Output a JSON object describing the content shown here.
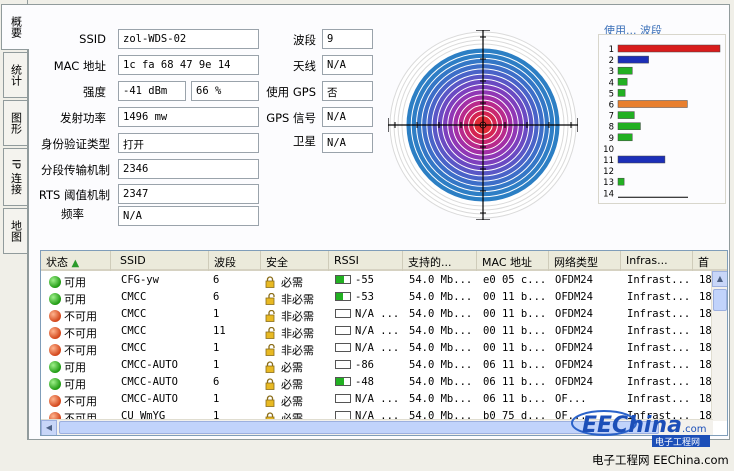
{
  "tabs": [
    {
      "label": "概要"
    },
    {
      "label": "统计"
    },
    {
      "label": "图形"
    },
    {
      "label": "IP 连接"
    },
    {
      "label": "地图"
    }
  ],
  "info": {
    "ssid_label": "SSID",
    "ssid": "zol-WDS-02",
    "mac_label": "MAC 地址",
    "mac": "1c fa 68 47 9e 14",
    "strength_label": "强度",
    "strength_dbm": "-41 dBm",
    "strength_pct": "66 %",
    "tx_label": "发射功率",
    "tx": "1496 mw",
    "auth_label": "身份验证类型",
    "auth": "打开",
    "frag_label": "分段传输机制",
    "frag": "2346",
    "rts_label": "RTS 阈值机制",
    "rts": "2347",
    "freq_label": "频率",
    "freq": "N/A",
    "band_label": "波段",
    "band": "9",
    "antenna_label": "天线",
    "antenna": "N/A",
    "gps_label": "使用 GPS",
    "gps": "否",
    "gps_signal_label": "GPS 信号",
    "gps_signal": "N/A",
    "sat_label": "卫星",
    "sat": "N/A"
  },
  "band_chart": {
    "title": "使用... 波段",
    "channels": [
      "1",
      "2",
      "3",
      "4",
      "5",
      "6",
      "7",
      "8",
      "9",
      "10",
      "11",
      "12",
      "13",
      "14"
    ],
    "values": [
      10,
      3,
      1.4,
      0.9,
      0.7,
      6.8,
      1.6,
      2.2,
      1.4,
      0,
      4.6,
      0,
      0.6,
      0
    ],
    "colors": [
      "#d81c1c",
      "#1c2fb8",
      "#22b022",
      "#22b022",
      "#22b022",
      "#e87f2e",
      "#22b022",
      "#22b022",
      "#22b022",
      "#22b022",
      "#1c2fb8",
      "#22b022",
      "#22b022",
      "#22b022"
    ],
    "max": 10
  },
  "table": {
    "headers": [
      "状态",
      "SSID",
      "波段",
      "安全",
      "RSSI",
      "支持的...",
      "MAC 地址",
      "网络类型",
      "Infras...",
      "首"
    ],
    "rows": [
      {
        "status": "可用",
        "ok": true,
        "ssid": "CFG-yw",
        "band": "6",
        "lock": "closed",
        "security": "必需",
        "rssi_fill": 0.55,
        "rssi": "-55",
        "rate": "54.0 Mb...",
        "mac": "e0 05 c...",
        "net": "OFDM24",
        "infra": "Infrast...",
        "first": "18"
      },
      {
        "status": "可用",
        "ok": true,
        "ssid": "CMCC",
        "band": "6",
        "lock": "open",
        "security": "非必需",
        "rssi_fill": 0.5,
        "rssi": "-53",
        "rate": "54.0 Mb...",
        "mac": "00 11 b...",
        "net": "OFDM24",
        "infra": "Infrast...",
        "first": "18"
      },
      {
        "status": "不可用",
        "ok": false,
        "ssid": "CMCC",
        "band": "1",
        "lock": "open",
        "security": "非必需",
        "rssi_fill": 0,
        "rssi": "N/A ...",
        "rate": "54.0 Mb...",
        "mac": "00 11 b...",
        "net": "OFDM24",
        "infra": "Infrast...",
        "first": "18"
      },
      {
        "status": "不可用",
        "ok": false,
        "ssid": "CMCC",
        "band": "11",
        "lock": "open",
        "security": "非必需",
        "rssi_fill": 0,
        "rssi": "N/A ...",
        "rate": "54.0 Mb...",
        "mac": "00 11 b...",
        "net": "OFDM24",
        "infra": "Infrast...",
        "first": "18"
      },
      {
        "status": "不可用",
        "ok": false,
        "ssid": "CMCC",
        "band": "1",
        "lock": "open",
        "security": "非必需",
        "rssi_fill": 0,
        "rssi": "N/A ...",
        "rate": "54.0 Mb...",
        "mac": "00 11 b...",
        "net": "OFDM24",
        "infra": "Infrast...",
        "first": "18"
      },
      {
        "status": "可用",
        "ok": true,
        "ssid": "CMCC-AUTO",
        "band": "1",
        "lock": "closed",
        "security": "必需",
        "rssi_fill": 0,
        "rssi": "-86",
        "rate": "54.0 Mb...",
        "mac": "06 11 b...",
        "net": "OFDM24",
        "infra": "Infrast...",
        "first": "18"
      },
      {
        "status": "可用",
        "ok": true,
        "ssid": "CMCC-AUTO",
        "band": "6",
        "lock": "closed",
        "security": "必需",
        "rssi_fill": 0.55,
        "rssi": "-48",
        "rate": "54.0 Mb...",
        "mac": "06 11 b...",
        "net": "OFDM24",
        "infra": "Infrast...",
        "first": "18"
      },
      {
        "status": "不可用",
        "ok": false,
        "ssid": "CMCC-AUTO",
        "band": "1",
        "lock": "closed",
        "security": "必需",
        "rssi_fill": 0,
        "rssi": "N/A ...",
        "rate": "54.0 Mb...",
        "mac": "06 11 b...",
        "net": "OF...",
        "infra": "Infrast...",
        "first": "18"
      },
      {
        "status": "不可用",
        "ok": false,
        "ssid": "CU_WmYG",
        "band": "1",
        "lock": "closed",
        "security": "必需",
        "rssi_fill": 0,
        "rssi": "N/A ...",
        "rate": "54.0 Mb...",
        "mac": "b0 75 d...",
        "net": "OF...",
        "infra": "Infrast...",
        "first": "18"
      }
    ]
  },
  "watermark": {
    "brand": "EEChina",
    "domain": ".com",
    "tagline": "电子工程网"
  },
  "footer": "电子工程网 EEChina.com"
}
